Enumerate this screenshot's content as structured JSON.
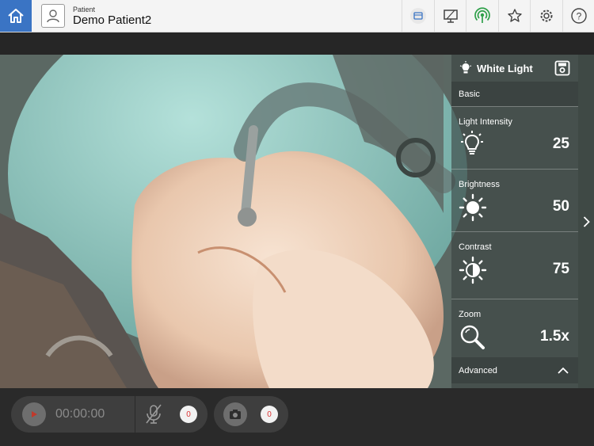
{
  "header": {
    "patient_label": "Patient",
    "patient_name": "Demo Patient2",
    "icons": [
      "home-icon",
      "avatar-icon",
      "record-card-icon",
      "monitor-icon",
      "wireless-icon",
      "star-icon",
      "gear-icon",
      "help-icon"
    ]
  },
  "panel": {
    "title": "White Light",
    "basic_label": "Basic",
    "advanced_label": "Advanced",
    "controls": [
      {
        "label": "Light Intensity",
        "value": "25",
        "icon": "bulb-icon"
      },
      {
        "label": "Brightness",
        "value": "50",
        "icon": "sun-icon"
      },
      {
        "label": "Contrast",
        "value": "75",
        "icon": "contrast-icon"
      },
      {
        "label": "Zoom",
        "value": "1.5x",
        "icon": "magnifier-icon"
      }
    ]
  },
  "bottom": {
    "timer": "00:00:00",
    "video_count": "0",
    "photo_count": "0"
  },
  "colors": {
    "accent": "#3a74c4",
    "panel": "#3b4341",
    "badge_text": "#d33"
  }
}
